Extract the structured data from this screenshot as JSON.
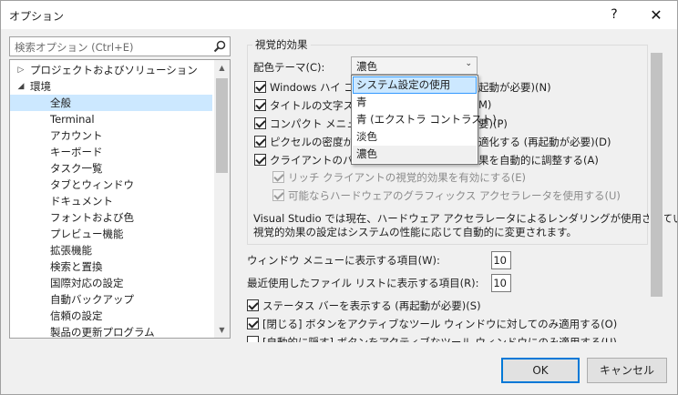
{
  "window": {
    "title": "オプション",
    "help": "?",
    "close": "✕"
  },
  "search": {
    "placeholder": "検索オプション (Ctrl+E)"
  },
  "tree": {
    "items": [
      {
        "label": "プロジェクトおよびソリューション",
        "arrow": "▷",
        "selected": false
      },
      {
        "label": "環境",
        "arrow": "◢",
        "selected": false
      },
      {
        "label": "全般",
        "selected": true
      },
      {
        "label": "Terminal"
      },
      {
        "label": "アカウント"
      },
      {
        "label": "キーボード"
      },
      {
        "label": "タスク一覧"
      },
      {
        "label": "タブとウィンドウ"
      },
      {
        "label": "ドキュメント"
      },
      {
        "label": "フォントおよび色"
      },
      {
        "label": "プレビュー機能"
      },
      {
        "label": "拡張機能"
      },
      {
        "label": "検索と置換"
      },
      {
        "label": "国際対応の設定"
      },
      {
        "label": "自動バックアップ"
      },
      {
        "label": "信頼の設定"
      },
      {
        "label": "製品の更新プログラム"
      }
    ]
  },
  "visual": {
    "group_title": "視覚的効果",
    "theme_label": "配色テーマ(C):",
    "theme_value": "濃色",
    "theme_options": [
      {
        "label": "システム設定の使用",
        "state": "hover"
      },
      {
        "label": "青",
        "state": ""
      },
      {
        "label": "青 (エクストラ コントラスト)",
        "state": ""
      },
      {
        "label": "淡色",
        "state": ""
      },
      {
        "label": "濃色",
        "state": "selected"
      }
    ],
    "checks": [
      {
        "left": "Windows ハイ コン",
        "right": "起動が必要)(N)",
        "checked": true
      },
      {
        "left": "タイトルの文字スタ",
        "right": "M)",
        "checked": true
      },
      {
        "left": "コンパクト メニューと",
        "right": "要)(P)",
        "checked": true
      },
      {
        "left": "ピクセルの密度が異",
        "right": "適化する (再起動が必要)(D)",
        "checked": true
      },
      {
        "left": "クライアントのパフォ",
        "right": "果を自動的に調整する(A)",
        "checked": true
      }
    ],
    "sub_checks": [
      {
        "label": "リッチ クライアントの視覚的効果を有効にする(E)",
        "checked": true
      },
      {
        "label": "可能ならハードウェアのグラフィックス アクセラレータを使用する(U)",
        "checked": true
      }
    ],
    "info_line1": "Visual Studio では現在、ハードウェア アクセラレータによるレンダリングが使用されています。",
    "info_line2": "視覚的効果の設定はシステムの性能に応じて自動的に変更されます。"
  },
  "menu_items": {
    "label": "ウィンドウ メニューに表示する項目(W):",
    "value": "10"
  },
  "recent_files": {
    "label": "最近使用したファイル リストに表示する項目(R):",
    "value": "10"
  },
  "bottom_checks": [
    {
      "label": "ステータス バーを表示する (再起動が必要)(S)",
      "checked": true
    },
    {
      "label": "[閉じる] ボタンをアクティブなツール ウィンドウに対してのみ適用する(O)",
      "checked": true
    },
    {
      "label": "[自動的に隠す] ボタンをアクティブなツール ウィンドウにのみ適用する(U)",
      "checked": false
    }
  ],
  "buttons": {
    "ok": "OK",
    "cancel": "キャンセル"
  },
  "colors": {
    "selection": "#cce8ff",
    "accent": "#0078d7",
    "dialog_bg": "#f0f0f0"
  }
}
